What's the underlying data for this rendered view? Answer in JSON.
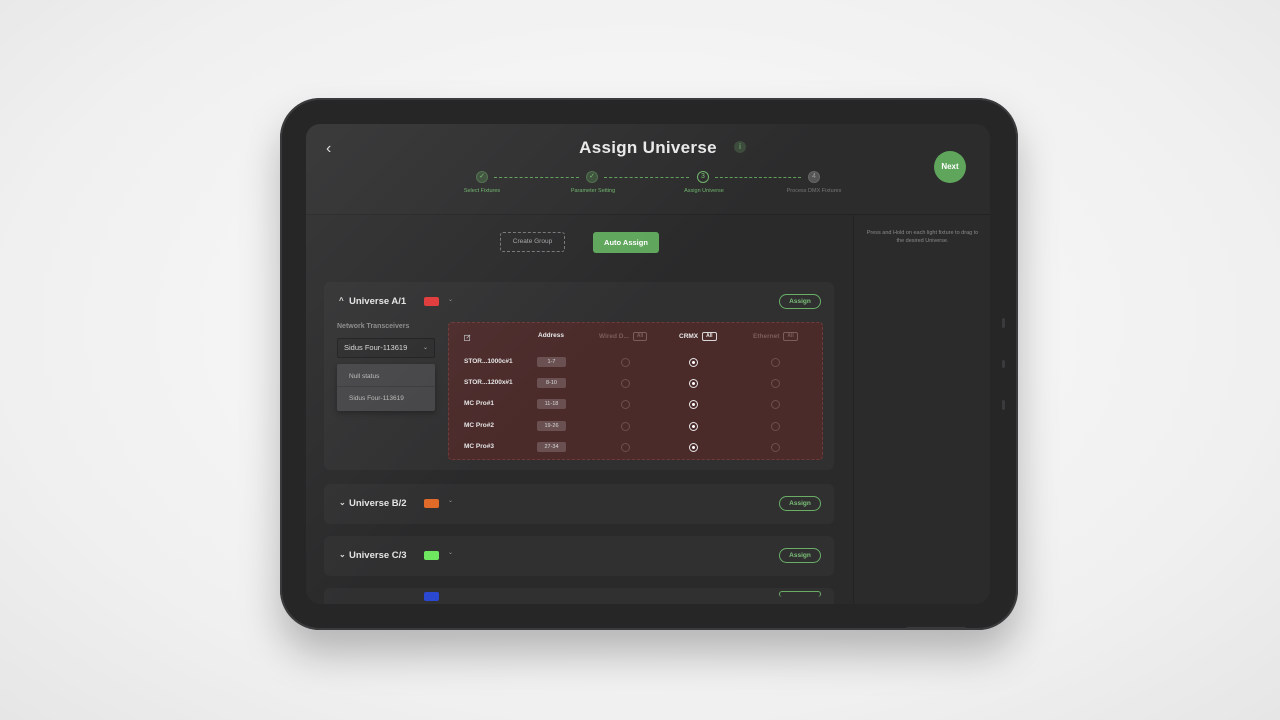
{
  "header": {
    "back_glyph": "‹",
    "title": "Assign Universe",
    "info_glyph": "i",
    "next_label": "Next"
  },
  "steps": [
    {
      "marker": "✓",
      "label": "Select Fixtures",
      "state": "done"
    },
    {
      "marker": "✓",
      "label": "Parameter Setting",
      "state": "done"
    },
    {
      "marker": "3",
      "label": "Assign Universe",
      "state": "current"
    },
    {
      "marker": "4",
      "label": "Process DMX Fixtures",
      "state": "todo"
    }
  ],
  "toolbar": {
    "create_group": "Create Group",
    "auto_assign": "Auto Assign"
  },
  "right_panel": {
    "hint": "Press and Hold on each light fixture to drag to the desired Universe."
  },
  "universe_a": {
    "chevron": "^",
    "title": "Universe A/1",
    "color": "#e0383a",
    "caret": "⌄",
    "assign_label": "Assign",
    "network_label": "Network Transceivers",
    "selected_transceiver": "Sidus Four-113619",
    "select_caret": "⌄",
    "menu_items": [
      "Null status",
      "Sidus Four-113619"
    ],
    "columns": {
      "address": "Address",
      "wired": "Wired D...",
      "crmx": "CRMX",
      "ethernet": "Ethernet",
      "all": "All"
    },
    "rows": [
      {
        "name": "STOR...1000c#1",
        "address": "1-7",
        "selected": "crmx"
      },
      {
        "name": "STOR...1200x#1",
        "address": "8-10",
        "selected": "crmx"
      },
      {
        "name": "MC Pro#1",
        "address": "11-18",
        "selected": "crmx"
      },
      {
        "name": "MC Pro#2",
        "address": "19-26",
        "selected": "crmx"
      },
      {
        "name": "MC Pro#3",
        "address": "27-34",
        "selected": "crmx"
      }
    ]
  },
  "universe_b": {
    "chevron": "⌄",
    "title": "Universe B/2",
    "color": "#e06a28",
    "caret": "⌄",
    "assign_label": "Assign"
  },
  "universe_c": {
    "chevron": "⌄",
    "title": "Universe C/3",
    "color": "#6ee660",
    "caret": "⌄",
    "assign_label": "Assign"
  },
  "universe_d_partial": {
    "color": "#2a48d0"
  }
}
